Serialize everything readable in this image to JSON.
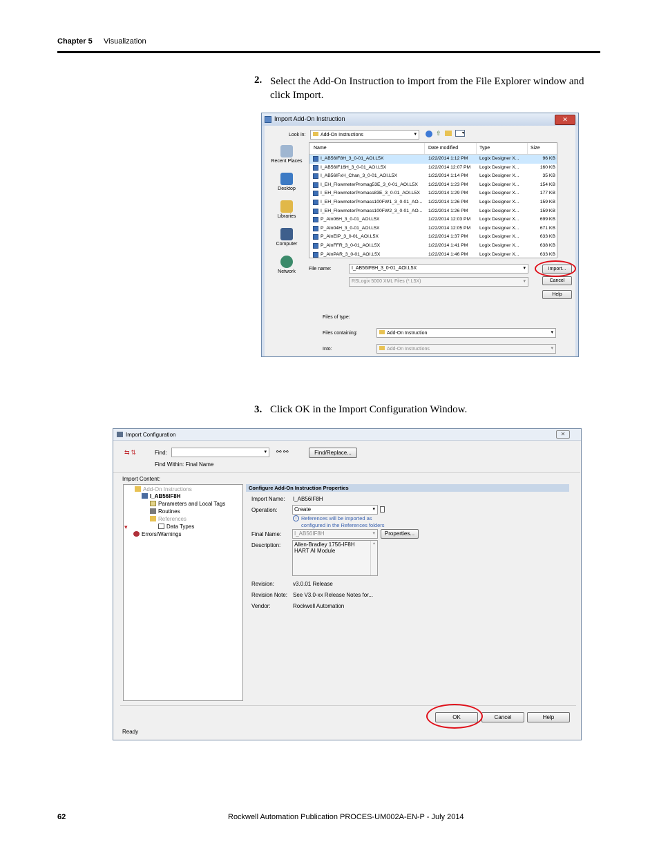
{
  "header": {
    "chapter": "Chapter 5",
    "section": "Visualization"
  },
  "steps": [
    {
      "num": "2.",
      "text": "Select the Add-On Instruction to import from the File Explorer window and click Import."
    },
    {
      "num": "3.",
      "text": "Click OK in the Import Configuration Window."
    }
  ],
  "import_aoi": {
    "title": "Import Add-On Instruction",
    "look_in_label": "Look in:",
    "look_in_value": "Add-On Instructions",
    "columns": [
      "Name",
      "Date modified",
      "Type",
      "Size"
    ],
    "places": [
      "Recent Places",
      "Desktop",
      "Libraries",
      "Computer",
      "Network"
    ],
    "files": [
      {
        "name": "I_AB56IF8H_3_0-01_AOI.L5X",
        "date": "1/22/2014 1:12 PM",
        "type": "Logix Designer X...",
        "size": "96 KB"
      },
      {
        "name": "I_AB56IF16H_3_0-01_AOI.L5X",
        "date": "1/22/2014 12:07 PM",
        "type": "Logix Designer X...",
        "size": "160 KB"
      },
      {
        "name": "I_AB56IFxH_Chan_3_0-01_AOI.L5X",
        "date": "1/22/2014 1:14 PM",
        "type": "Logix Designer X...",
        "size": "35 KB"
      },
      {
        "name": "I_EH_FlowmeterPromag53E_3_0-01_AOI.L5X",
        "date": "1/22/2014 1:23 PM",
        "type": "Logix Designer X...",
        "size": "154 KB"
      },
      {
        "name": "I_EH_FlowmeterPromass83E_3_0-01_AOI.L5X",
        "date": "1/22/2014 1:29 PM",
        "type": "Logix Designer X...",
        "size": "177 KB"
      },
      {
        "name": "I_EH_FlowmeterPromass100FW1_3_0-01_AO...",
        "date": "1/22/2014 1:26 PM",
        "type": "Logix Designer X...",
        "size": "159 KB"
      },
      {
        "name": "I_EH_FlowmeterPromass100FW2_3_0-01_AO...",
        "date": "1/22/2014 1:26 PM",
        "type": "Logix Designer X...",
        "size": "159 KB"
      },
      {
        "name": "P_AIn06H_3_0-01_AOI.L5X",
        "date": "1/22/2014 12:03 PM",
        "type": "Logix Designer X...",
        "size": "699 KB"
      },
      {
        "name": "P_AIn04H_3_0-01_AOI.L5X",
        "date": "1/22/2014 12:05 PM",
        "type": "Logix Designer X...",
        "size": "671 KB"
      },
      {
        "name": "P_AInEIP_3_0-01_AOI.L5X",
        "date": "1/22/2014 1:37 PM",
        "type": "Logix Designer X...",
        "size": "633 KB"
      },
      {
        "name": "P_AInFFR_3_0-01_AOI.L5X",
        "date": "1/22/2014 1:41 PM",
        "type": "Logix Designer X...",
        "size": "638 KB"
      },
      {
        "name": "P_AInPAR_3_0-01_AOI.L5X",
        "date": "1/22/2014 1:46 PM",
        "type": "Logix Designer X...",
        "size": "633 KB"
      }
    ],
    "file_name_label": "File name:",
    "file_name_value": "I_AB56IF8H_3_0-01_AOI.L5X",
    "file_type_value": "RSLogix 5000 XML Files (*.L5X)",
    "import_btn": "Import...",
    "cancel_btn": "Cancel",
    "help_btn": "Help",
    "files_of_type_label": "Files of type:",
    "files_containing_label": "Files containing:",
    "files_containing_value": "Add-On Instruction",
    "into_label": "Into:",
    "into_value": "Add-On Instructions"
  },
  "import_config": {
    "title": "Import Configuration",
    "find_label": "Find:",
    "find_within": "Find Within: Final Name",
    "find_replace_btn": "Find/Replace...",
    "import_content_label": "Import Content:",
    "tree": [
      "Add-On Instructions",
      "I_AB56IF8H",
      "Parameters and Local Tags",
      "Routines",
      "References",
      "Data Types",
      "Errors/Warnings"
    ],
    "pane_title": "Configure Add-On Instruction Properties",
    "import_name_label": "Import Name:",
    "import_name_value": "I_AB56IF8H",
    "operation_label": "Operation:",
    "operation_value": "Create",
    "info_line1": "References will be imported as",
    "info_line2": "configured in the References folders",
    "final_name_label": "Final Name:",
    "final_name_value": "I_AB56IF8H",
    "properties_btn": "Properties...",
    "description_label": "Description:",
    "description_line1": "Allen-Bradley 1756-IF8H",
    "description_line2": "HART AI Module",
    "revision_label": "Revision:",
    "revision_value": "v3.0.01 Release",
    "revision_note_label": "Revision Note:",
    "revision_note_value": "See V3.0-xx Release Notes for...",
    "vendor_label": "Vendor:",
    "vendor_value": "Rockwell Automation",
    "ok_btn": "OK",
    "cancel_btn": "Cancel",
    "help_btn": "Help",
    "status": "Ready"
  },
  "footer": {
    "page": "62",
    "publication": "Rockwell Automation Publication PROCES-UM002A-EN-P - July 2014"
  },
  "colors": {
    "annotation": "#e0101a",
    "selection": "#cce8ff",
    "pane_header": "#c7d6e8"
  }
}
